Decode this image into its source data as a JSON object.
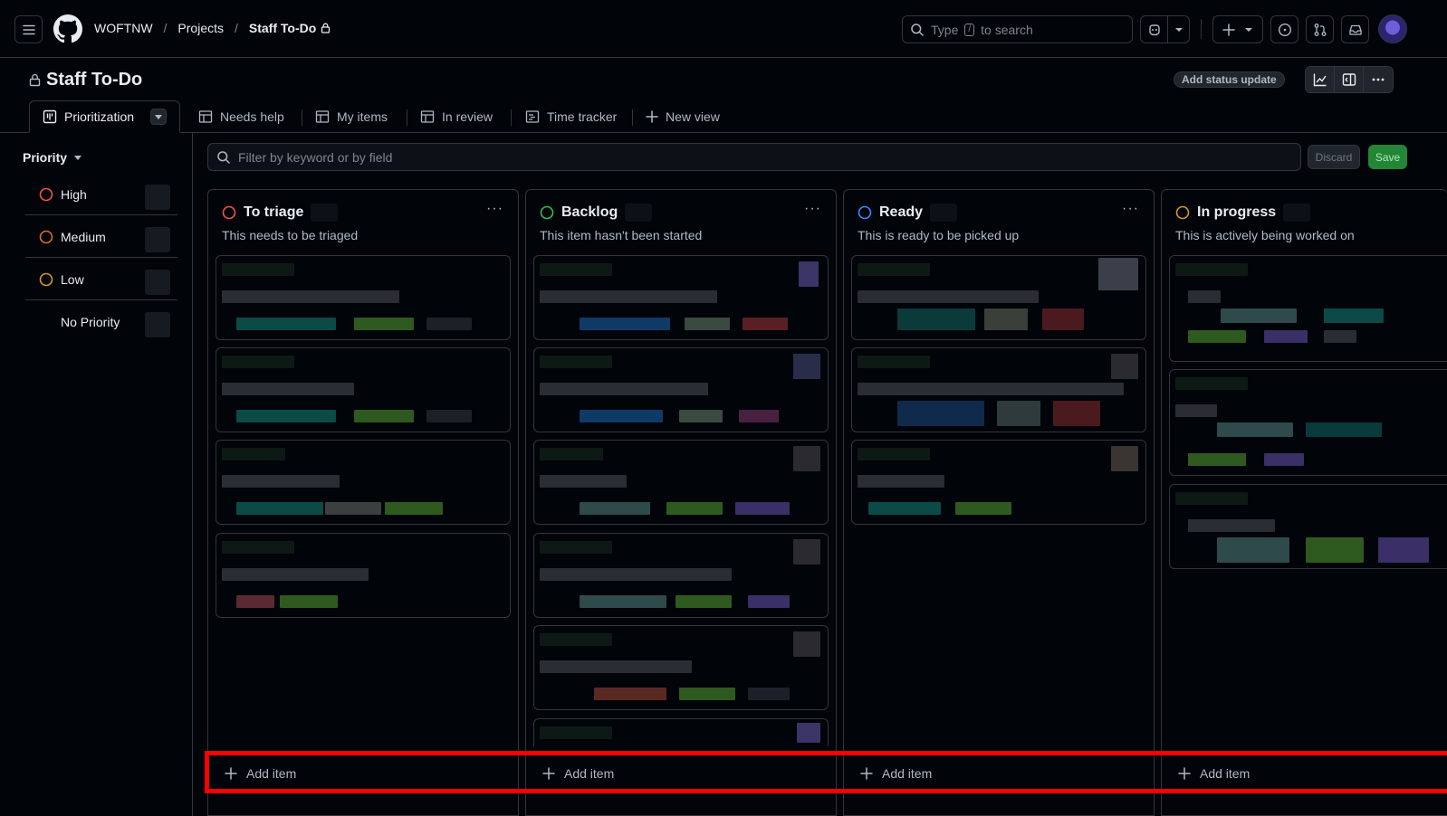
{
  "header": {
    "org": "WOFTNW",
    "projects": "Projects",
    "project": "Staff To-Do",
    "search_prefix": "Type",
    "search_key": "/",
    "search_suffix": "to search"
  },
  "project": {
    "title": "Staff To-Do",
    "status_update": "Add status update"
  },
  "tabs": [
    {
      "label": "Prioritization"
    },
    {
      "label": "Needs help"
    },
    {
      "label": "My items"
    },
    {
      "label": "In review"
    },
    {
      "label": "Time tracker"
    },
    {
      "label": "New view"
    }
  ],
  "sidebar": {
    "title": "Priority",
    "items": [
      {
        "label": "High",
        "color": "#f85149"
      },
      {
        "label": "Medium",
        "color": "#db6d28"
      },
      {
        "label": "Low",
        "color": "#d29922"
      },
      {
        "label": "No Priority",
        "color": ""
      }
    ]
  },
  "filter": {
    "placeholder": "Filter by keyword or by field",
    "discard": "Discard",
    "save": "Save"
  },
  "columns": [
    {
      "title": "To triage",
      "desc": "This needs to be triaged",
      "color": "#f85149",
      "add": "Add item"
    },
    {
      "title": "Backlog",
      "desc": "This item hasn't been started",
      "color": "#3fb950",
      "add": "Add item"
    },
    {
      "title": "Ready",
      "desc": "This is ready to be picked up",
      "color": "#388bfd",
      "add": "Add item"
    },
    {
      "title": "In progress",
      "desc": "This is actively being worked on",
      "color": "#d29922",
      "add": "Add item"
    }
  ]
}
